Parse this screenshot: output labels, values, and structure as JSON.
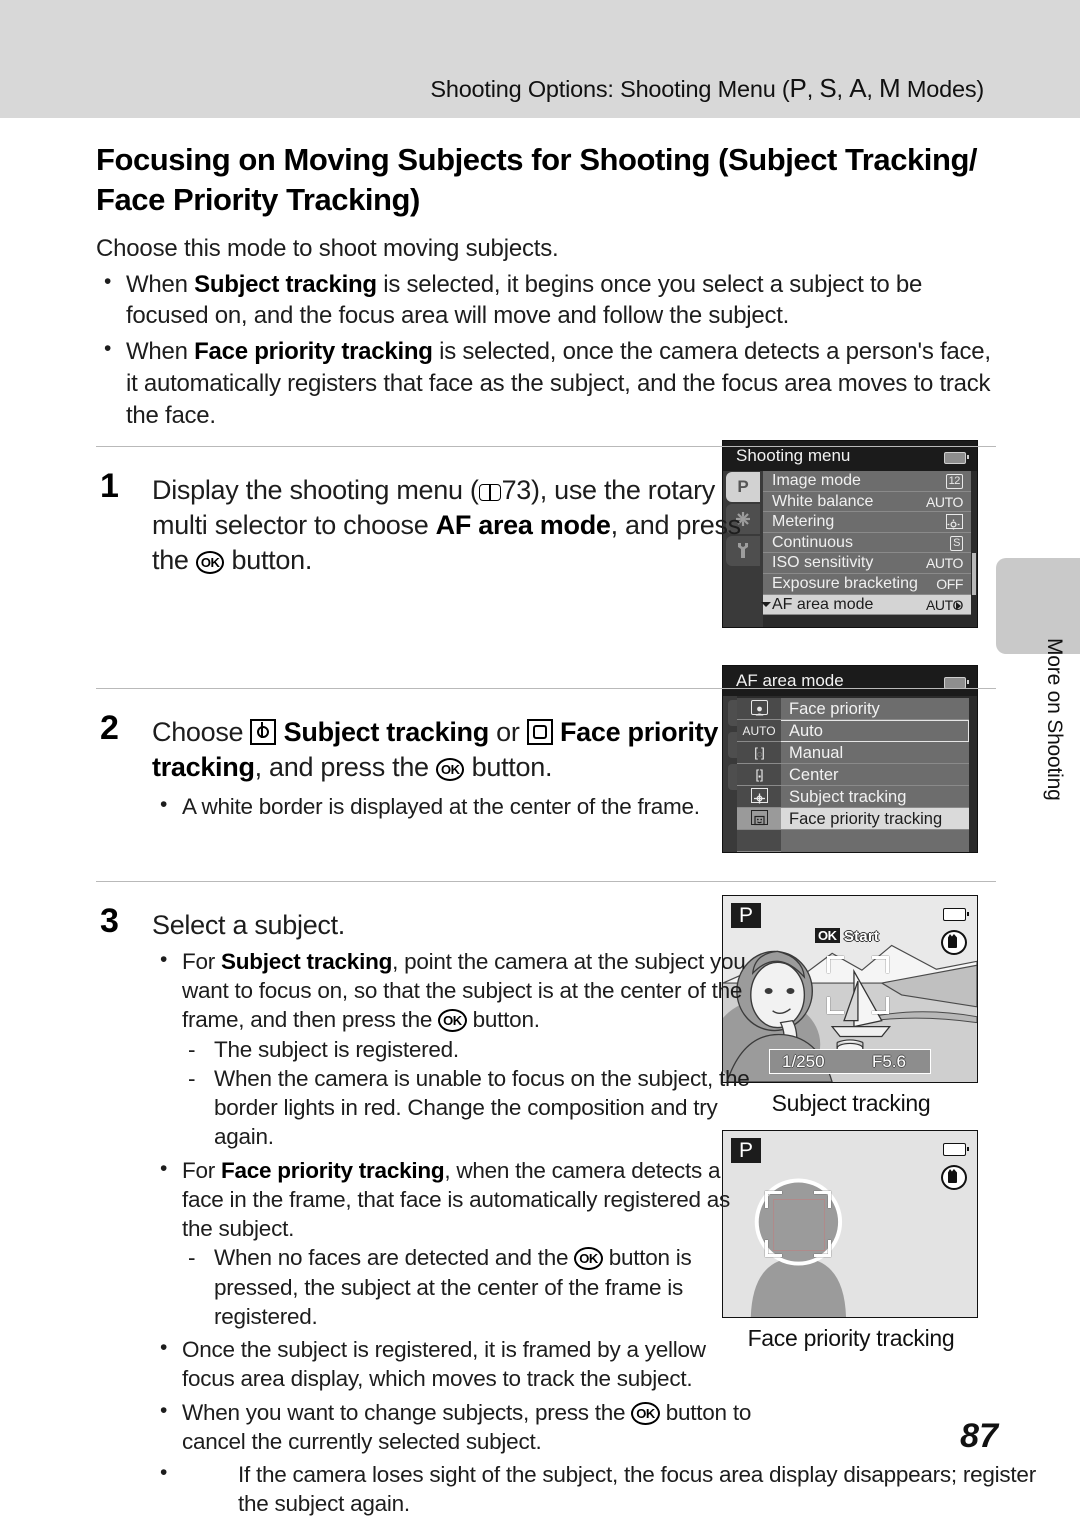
{
  "running_head": {
    "prefix": "Shooting Options: Shooting Menu (",
    "modes": [
      "P",
      "S",
      "A",
      "M"
    ],
    "suffix": " Modes)",
    "full": "Shooting Options: Shooting Menu (P, S, A, M Modes)"
  },
  "page_title": "Focusing on Moving Subjects for Shooting (Subject Tracking/ Face Priority Tracking)",
  "lead": "Choose this mode to shoot moving subjects.",
  "intro_bullets": [
    {
      "pre": "When ",
      "bold": "Subject tracking",
      "post": " is selected, it begins once you select a subject to be focused on, and the focus area will move and follow the subject."
    },
    {
      "pre": "When ",
      "bold": "Face priority tracking",
      "post": " is selected, once the camera detects a person's face, it automatically registers that face as the subject, and the focus area moves to track the face."
    }
  ],
  "steps": [
    {
      "num": "1",
      "text_a": "Display the shooting menu (",
      "ref": "73",
      "text_b": "), use the rotary multi selector to choose ",
      "bold": "AF area mode",
      "text_c": ", and press the ",
      "ok": "OK",
      "text_d": " button."
    },
    {
      "num": "2",
      "text_a": "Choose ",
      "bold_a": "Subject tracking",
      "text_b": " or ",
      "bold_b": "Face priority tracking",
      "text_c": ", and press the ",
      "ok": "OK",
      "text_d": " button.",
      "bullets": [
        {
          "text": "A white border is displayed at the center of the frame."
        }
      ]
    },
    {
      "num": "3",
      "heading": "Select a subject.",
      "bullets": [
        {
          "pre": "For ",
          "bold": "Subject tracking",
          "post": ", point the camera at the subject you want to focus on, so that the subject is at the center of the frame, and then press the ",
          "ok": "OK",
          "tail": " button.",
          "dashes": [
            "The subject is registered.",
            "When the camera is unable to focus on the subject, the border lights in red. Change the composition and try again."
          ]
        },
        {
          "pre": "For ",
          "bold": "Face priority tracking",
          "post": ", when the camera detects a face in the frame, that face is automatically registered as the subject.",
          "dashes_with_ok": [
            {
              "pre": "When no faces are detected and the ",
              "ok": "OK",
              "post": " button is pressed, the subject at the center of the frame is registered."
            }
          ]
        },
        {
          "plain": "Once the subject is registered, it is framed by a yellow focus area display, which moves to track the subject."
        },
        {
          "pre_ok": "When you want to change subjects, press the ",
          "ok": "OK",
          "post_ok": " button to cancel the currently selected subject."
        },
        {
          "plain": "If the camera loses sight of the subject, the focus area display disappears; register the subject again."
        }
      ]
    }
  ],
  "figures": {
    "shooting_menu": {
      "title": "Shooting menu",
      "tabs": [
        {
          "name": "P",
          "active": true
        },
        {
          "name": "movie",
          "active": false
        },
        {
          "name": "wrench",
          "active": false
        }
      ],
      "rows": [
        {
          "label": "Image mode",
          "value": "12",
          "value_type": "badge-image",
          "selected": false
        },
        {
          "label": "White balance",
          "value": "AUTO",
          "value_type": "text",
          "selected": false
        },
        {
          "label": "Metering",
          "value": "matrix",
          "value_type": "badge-metering",
          "selected": false
        },
        {
          "label": "Continuous",
          "value": "S",
          "value_type": "badge-continuous",
          "selected": false
        },
        {
          "label": "ISO sensitivity",
          "value": "AUTO",
          "value_type": "text",
          "selected": false
        },
        {
          "label": "Exposure bracketing",
          "value": "OFF",
          "value_type": "text",
          "selected": false
        },
        {
          "label": "AF area mode",
          "value": "AUTO",
          "value_type": "text",
          "selected": true
        }
      ]
    },
    "af_area_mode": {
      "title": "AF area mode",
      "rows": [
        {
          "label": "Face priority",
          "icon": "face-priority-icon",
          "icon_text": "",
          "state": "normal"
        },
        {
          "label": "Auto",
          "icon": "auto-icon",
          "icon_text": "AUTO",
          "state": "cursor"
        },
        {
          "label": "Manual",
          "icon": "manual-icon",
          "icon_text": "",
          "state": "normal"
        },
        {
          "label": "Center",
          "icon": "center-icon",
          "icon_text": "",
          "state": "normal"
        },
        {
          "label": "Subject tracking",
          "icon": "subject-tracking-icon",
          "icon_text": "",
          "state": "normal"
        },
        {
          "label": "Face priority tracking",
          "icon": "face-priority-tracking-icon",
          "icon_text": "",
          "state": "selected"
        }
      ]
    },
    "subject_tracking": {
      "caption": "Subject tracking",
      "mode": "P",
      "ok_label": "OK",
      "start_label": "Start",
      "shutter_speed": "1/250",
      "aperture": "F5.6"
    },
    "face_priority_tracking": {
      "caption": "Face priority tracking",
      "mode": "P"
    }
  },
  "side_tab": {
    "label": "More on Shooting"
  },
  "folio": "87"
}
